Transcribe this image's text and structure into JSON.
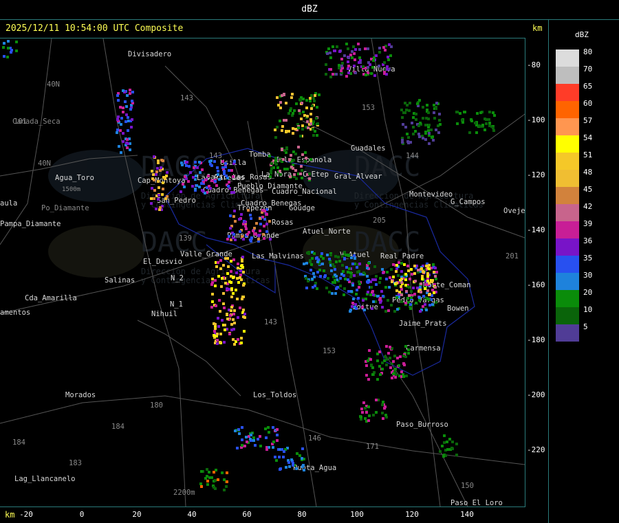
{
  "window": {
    "title": "dBZ"
  },
  "header": {
    "timestamp_line": "2025/12/11 10:54:00 UTC Composite",
    "units_top": "km",
    "units_bottom": "km"
  },
  "axes": {
    "y_ticks": [
      "-80",
      "-100",
      "-120",
      "-140",
      "-160",
      "-180",
      "-200",
      "-220"
    ],
    "x_ticks": [
      "-20",
      "0",
      "20",
      "40",
      "60",
      "80",
      "100",
      "120",
      "140"
    ]
  },
  "legend": {
    "title": "dBZ",
    "entries": [
      {
        "label": "80",
        "color": "#dcdcdc"
      },
      {
        "label": "70",
        "color": "#bebebe"
      },
      {
        "label": "65",
        "color": "#ff3c28"
      },
      {
        "label": "60",
        "color": "#ff6400"
      },
      {
        "label": "57",
        "color": "#ff9650"
      },
      {
        "label": "54",
        "color": "#ffff00"
      },
      {
        "label": "51",
        "color": "#f5c828"
      },
      {
        "label": "48",
        "color": "#f0be32"
      },
      {
        "label": "45",
        "color": "#d2823c"
      },
      {
        "label": "42",
        "color": "#c8648c"
      },
      {
        "label": "39",
        "color": "#c81e96"
      },
      {
        "label": "36",
        "color": "#7814c8"
      },
      {
        "label": "35",
        "color": "#2850f0"
      },
      {
        "label": "30",
        "color": "#1e82dc"
      },
      {
        "label": "20",
        "color": "#0a8c0a"
      },
      {
        "label": "10",
        "color": "#0a640a"
      },
      {
        "label": "5",
        "color": "#503c96"
      }
    ]
  },
  "places": [
    "Divisadero",
    "40N",
    "101",
    "40N",
    "Agua_Toro",
    "1500m",
    "aula",
    "Po_Diamante",
    "Pampa_Diamante",
    "Salinas",
    "Cda_Amarilla",
    "amentos",
    "Nihuil",
    "N_1",
    "N_2",
    "El_Desvio",
    "Valle_Grande",
    "Las_Malvinas",
    "Morados",
    "180",
    "184",
    "184",
    "183",
    "Lag_Llancanelo",
    "2200m",
    "Punta_Agua",
    "Los_Toldos",
    "Paso_Burroso",
    "Paso_El_Loro",
    "143",
    "153",
    "Guadales",
    "Villa_Nueva",
    "Montevideo",
    "Tomba",
    "Isla_Espanola",
    "Usilla",
    "La_Nora",
    "C_Etep",
    "Gral_Alvear",
    "Cuadro_Benegas",
    "Pueblo_Diamante",
    "Cuadro_Nacional",
    "Tropezon",
    "Goudge",
    "Rosas",
    "Pampa_Grande",
    "Atuel_Norte",
    "V_Atuel",
    "Real_Padre",
    "Soitue",
    "Monte_Coman",
    "Bowen",
    "Carmensa",
    "Jaime_Prats",
    "G_Campos",
    "Ovejero",
    "Cap_Montoya",
    "San_Pedro",
    "Las_Paredes",
    "Pedro_Vargas",
    "Salto_Las_Rosas",
    "Cuadro_Benegas",
    "Canada_Seca",
    "201",
    "205",
    "171",
    "150",
    "143",
    "139",
    "144",
    "146",
    "143",
    "153",
    "184"
  ],
  "watermark": {
    "brand": "DACC",
    "line1": "Direccion de Agricultura",
    "line2": "y Contingencias Climaticas"
  }
}
